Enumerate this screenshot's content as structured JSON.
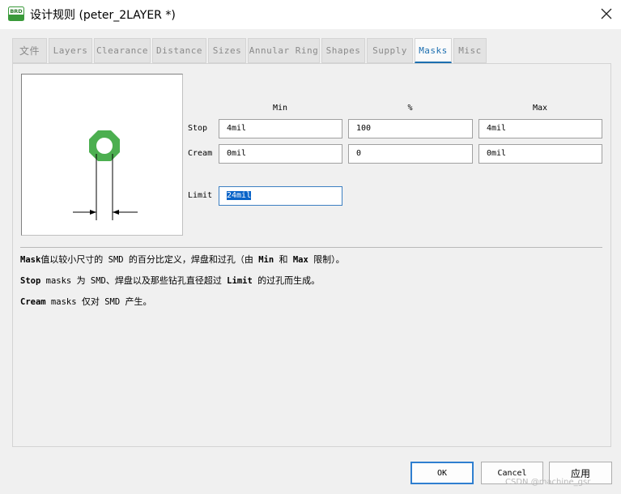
{
  "window": {
    "icon_label": "BRD",
    "title": "设计规则 (peter_2LAYER *)"
  },
  "tabs": [
    {
      "label": "文件"
    },
    {
      "label": "Layers"
    },
    {
      "label": "Clearance"
    },
    {
      "label": "Distance"
    },
    {
      "label": "Sizes"
    },
    {
      "label": "Annular Ring"
    },
    {
      "label": "Shapes"
    },
    {
      "label": "Supply"
    },
    {
      "label": "Masks",
      "active": true
    },
    {
      "label": "Misc"
    }
  ],
  "masks": {
    "columns": {
      "min": "Min",
      "percent": "%",
      "max": "Max"
    },
    "stop": {
      "label": "Stop",
      "min": "4mil",
      "percent": "100",
      "max": "4mil"
    },
    "cream": {
      "label": "Cream",
      "min": "0mil",
      "percent": "0",
      "max": "0mil"
    },
    "limit": {
      "label": "Limit",
      "value": "24mil"
    }
  },
  "preview": {
    "pad_color": "#4caf50"
  },
  "description": {
    "line1": {
      "p1": "Mask",
      "p2": "值以较小尺寸的",
      "p3": " SMD ",
      "p4": "的百分比定义，焊盘和过孔（由",
      "p5": " Min ",
      "p6": "和",
      "p7": " Max ",
      "p8": "限制）。"
    },
    "line2": {
      "p1": "Stop",
      "p2": " masks ",
      "p3": "为",
      "p4": " SMD",
      "p5": "、焊盘以及那些钻孔直径超过",
      "p6": " Limit ",
      "p7": "的过孔而生成。"
    },
    "line3": {
      "p1": "Cream",
      "p2": " masks ",
      "p3": "仅对",
      "p4": " SMD ",
      "p5": "产生。"
    }
  },
  "buttons": {
    "ok": "OK",
    "cancel": "Cancel",
    "apply": "应用"
  },
  "watermark": "CSDN @machine_gsr"
}
